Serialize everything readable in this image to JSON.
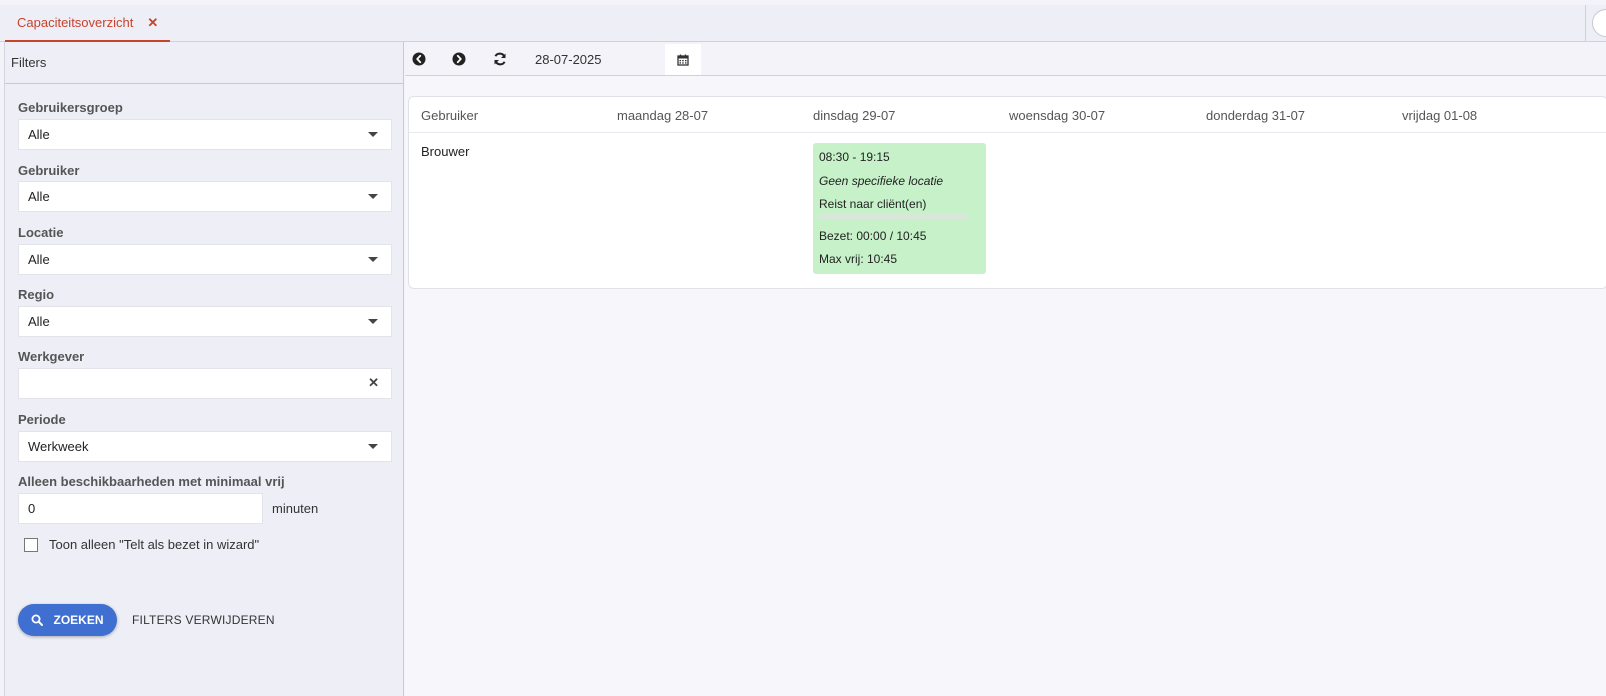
{
  "tab": {
    "title": "Capaciteitsoverzicht",
    "close": "✕"
  },
  "sidebar": {
    "header": "Filters",
    "fields": {
      "gebruikersgroep": {
        "label": "Gebruikersgroep",
        "value": "Alle"
      },
      "gebruiker": {
        "label": "Gebruiker",
        "value": "Alle"
      },
      "locatie": {
        "label": "Locatie",
        "value": "Alle"
      },
      "regio": {
        "label": "Regio",
        "value": "Alle"
      },
      "werkgever": {
        "label": "Werkgever",
        "value": "",
        "clear": "✕"
      },
      "periode": {
        "label": "Periode",
        "value": "Werkweek"
      },
      "minimaal": {
        "label": "Alleen beschikbaarheden met minimaal vrij",
        "value": "0",
        "unit": "minuten"
      }
    },
    "checkbox": {
      "label": "Toon alleen \"Telt als bezet in wizard\"",
      "checked": false
    },
    "search_button": "ZOEKEN",
    "clear_button": "FILTERS VERWIJDEREN"
  },
  "toolbar": {
    "date": "28-07-2025"
  },
  "grid": {
    "columns": [
      "Gebruiker",
      "maandag 28-07",
      "dinsdag 29-07",
      "woensdag 30-07",
      "donderdag 31-07",
      "vrijdag 01-08"
    ],
    "rows": [
      {
        "user": "Brouwer",
        "slot": {
          "day": "dinsdag 29-07",
          "time": "08:30 - 19:15",
          "location": "Geen specifieke locatie",
          "travel": "Reist naar cliënt(en)",
          "occupied_fraction": 0,
          "occupied": "Bezet: 00:00 / 10:45",
          "max_free": "Max vrij: 10:45"
        }
      }
    ]
  },
  "colors": {
    "accent": "#c7432c",
    "primary": "#3f6fd0",
    "slot": "#c6f1c9"
  }
}
